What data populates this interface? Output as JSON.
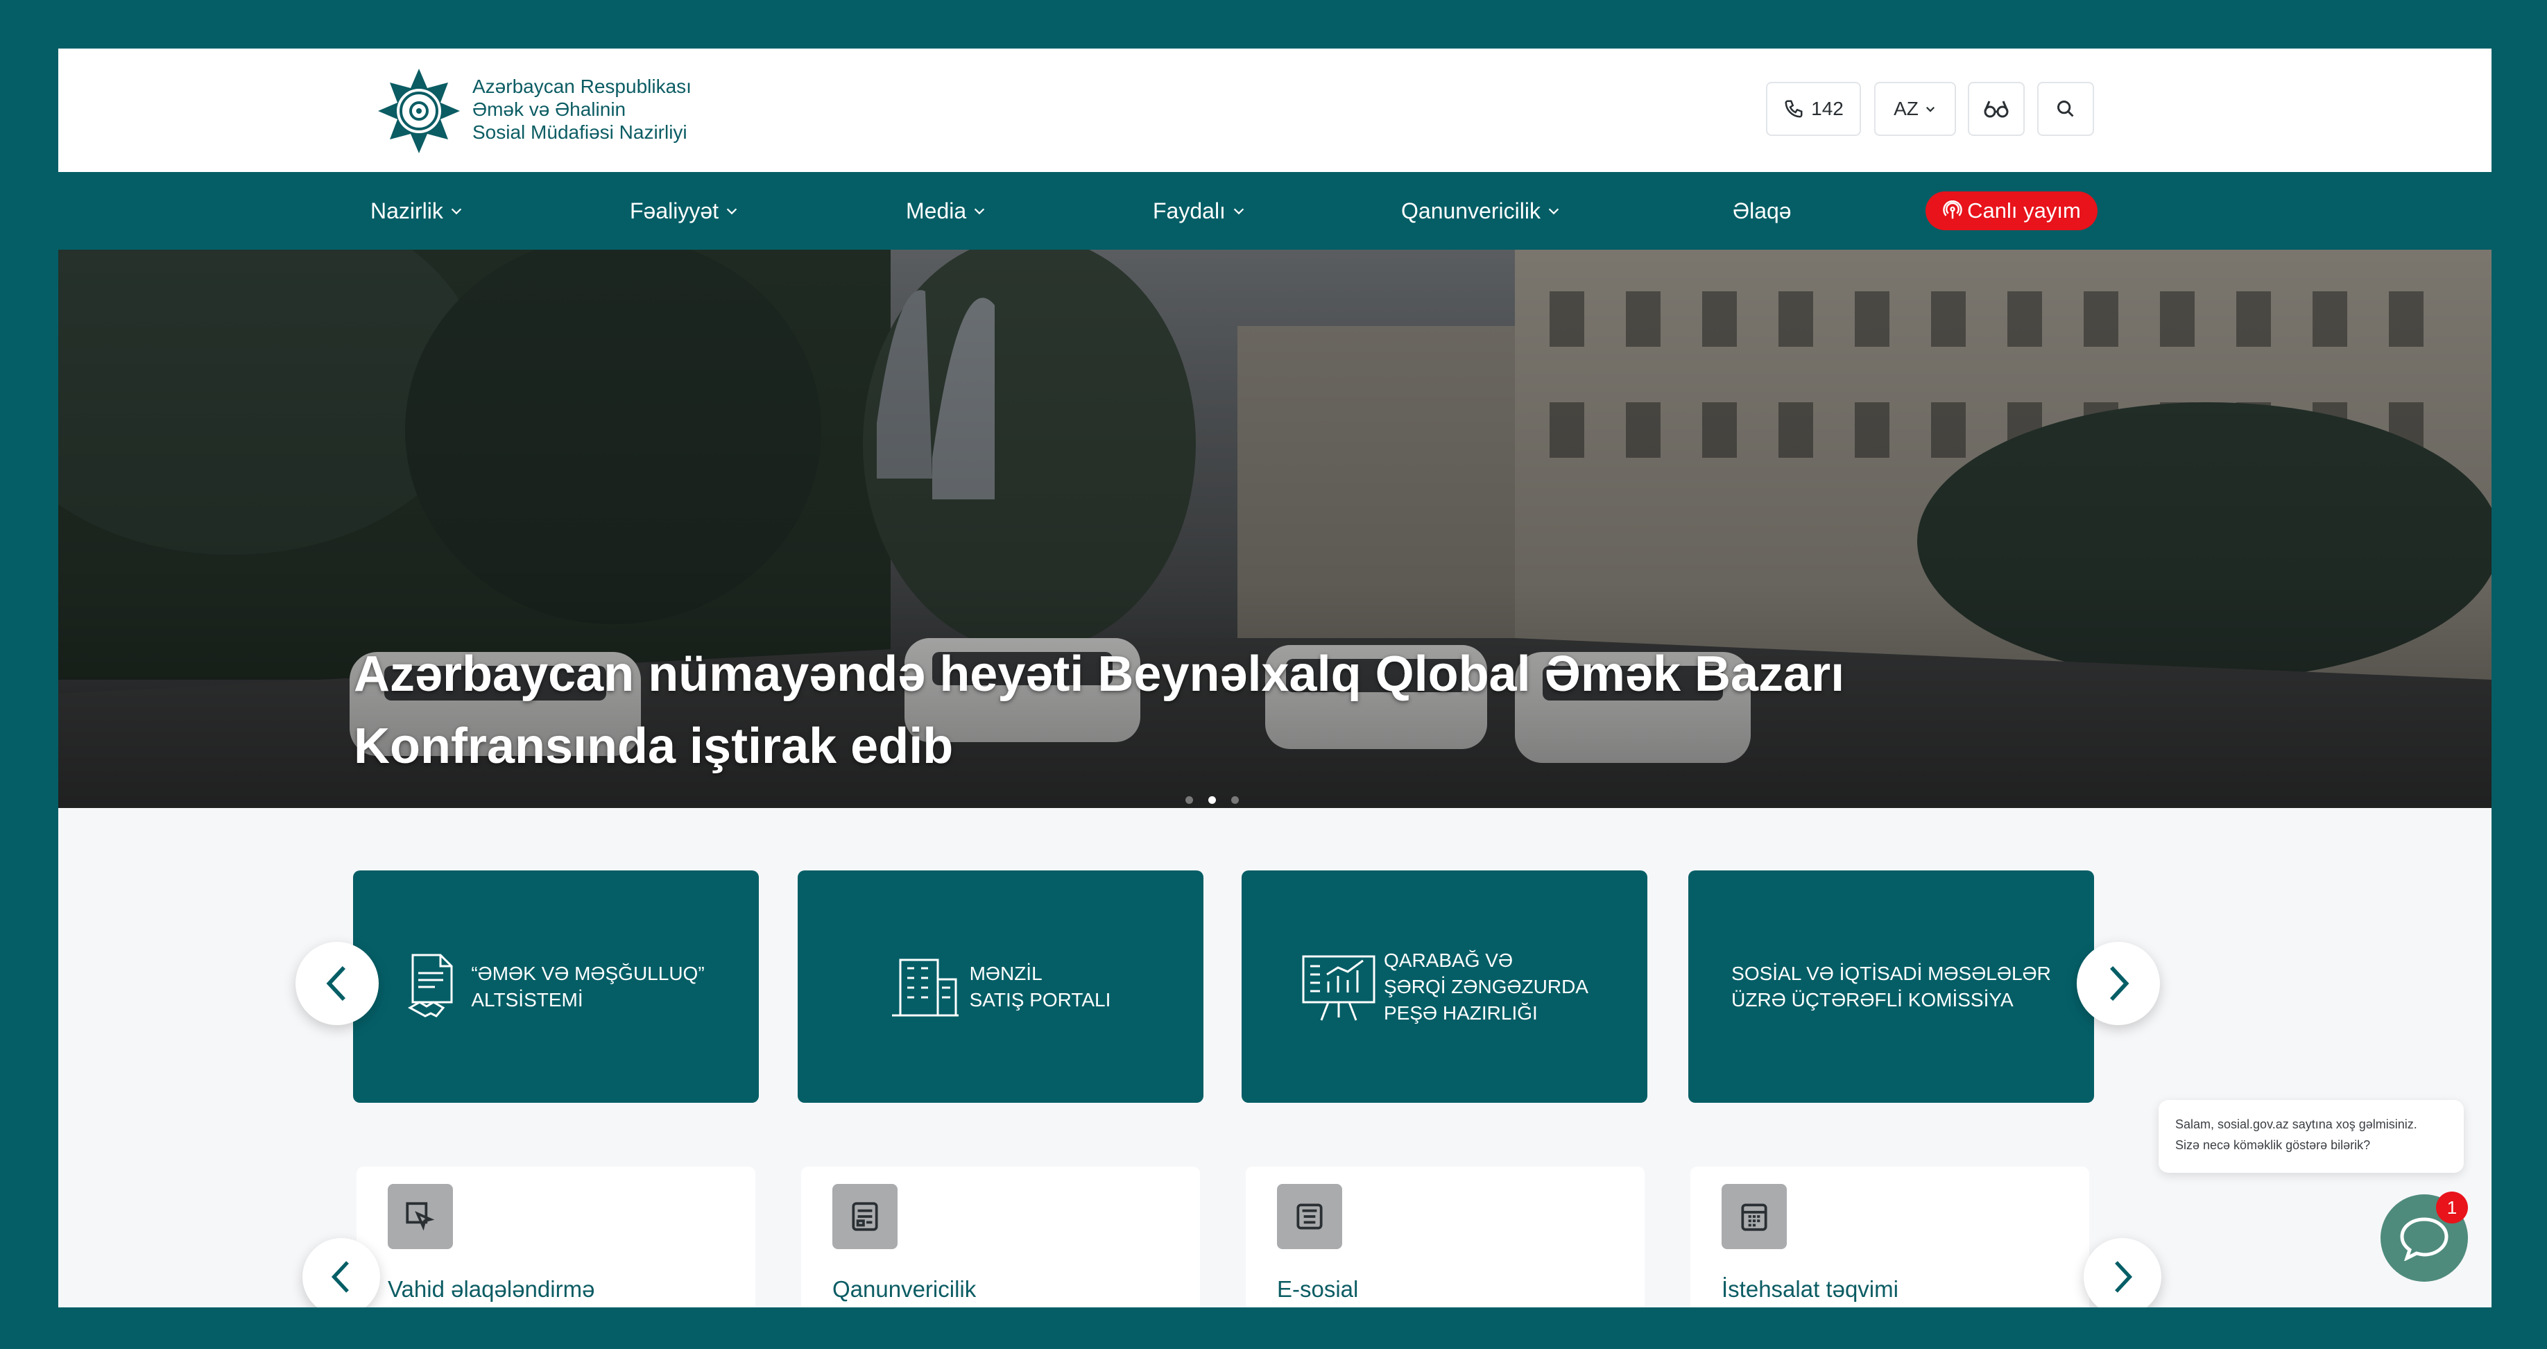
{
  "header": {
    "logo_lines": [
      "Azərbaycan Respublikası",
      "Əmək və Əhalinin",
      "Sosial Müdafiəsi Nazirliyi"
    ],
    "phone_label": "142",
    "lang_label": "AZ",
    "icons": [
      "phone-icon",
      "chevron-down-icon",
      "accessibility-glasses-icon",
      "search-icon"
    ]
  },
  "nav": {
    "items": [
      {
        "label": "Nazirlik"
      },
      {
        "label": "Fəaliyyət"
      },
      {
        "label": "Media"
      },
      {
        "label": "Faydalı"
      },
      {
        "label": "Qanunvericilik"
      },
      {
        "label": "Əlaqə"
      }
    ],
    "live_label": "Canlı yayım"
  },
  "hero": {
    "title": "Azərbaycan nümayəndə heyəti Beynəlxalq Qlobal Əmək Bazarı Konfransında iştirak edib",
    "slide_count": 3,
    "active_slide": 2
  },
  "cards": [
    {
      "lines": [
        "“ƏMƏK VƏ MƏŞĞULLUQ”",
        "ALTSİSTEMİ"
      ],
      "icon": "handshake-document-icon"
    },
    {
      "lines": [
        "MƏNZİL",
        "SATIŞ PORTALI"
      ],
      "icon": "building-icon"
    },
    {
      "lines": [
        "QARABAĞ VƏ",
        "ŞƏRQİ ZƏNGƏZURDA",
        "PEŞƏ HAZIRLIĞI"
      ],
      "icon": "presentation-chart-icon"
    },
    {
      "lines": [
        "SOSİAL VƏ İQTİSADİ MƏSƏLƏLƏR",
        "ÜZRƏ ÜÇTƏRƏFLİ KOMİSSİYA"
      ],
      "icon": ""
    }
  ],
  "services": [
    {
      "label": "Vahid əlaqələndirmə",
      "icon": "cursor-click-icon"
    },
    {
      "label": "Qanunvericilik",
      "icon": "document-list-icon"
    },
    {
      "label": "E-sosial",
      "icon": "e-service-icon"
    },
    {
      "label": "İstehsalat təqvimi",
      "icon": "calendar-icon"
    }
  ],
  "chat": {
    "message_lines": [
      "Salam, sosial.gov.az saytına xoş gəlmisiniz.",
      "Sizə necə köməklik göstərə bilərik?"
    ],
    "badge": "1"
  },
  "colors": {
    "brand": "#055e66",
    "live": "#e8131b",
    "chat": "#4e8b7c"
  }
}
